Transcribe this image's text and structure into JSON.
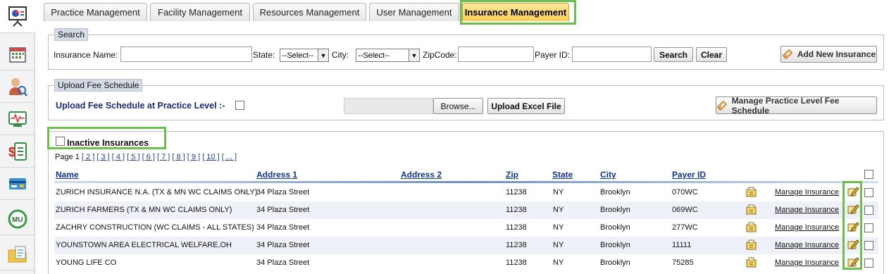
{
  "sidebar": {
    "items": [
      {
        "icon": "presentation-chart-icon"
      },
      {
        "icon": "calendar-icon"
      },
      {
        "icon": "user-search-icon"
      },
      {
        "icon": "heartbeat-monitor-icon"
      },
      {
        "icon": "billing-document-icon"
      },
      {
        "icon": "credit-card-icon"
      },
      {
        "icon": "mu-cycle-icon"
      },
      {
        "icon": "folder-documents-icon"
      }
    ]
  },
  "tabs": [
    {
      "label": "Practice Management",
      "active": false
    },
    {
      "label": "Facility Management",
      "active": false
    },
    {
      "label": "Resources Management",
      "active": false
    },
    {
      "label": "User Management",
      "active": false
    },
    {
      "label": "Insurance Management",
      "active": true
    }
  ],
  "search": {
    "legend": "Search",
    "insurance_name_label": "Insurance Name:",
    "insurance_name_value": "",
    "state_label": "State:",
    "state_value": "--Select--",
    "city_label": "City:",
    "city_value": "--Select--",
    "zip_label": "ZipCode:",
    "zip_value": "",
    "payer_label": "Payer ID:",
    "payer_value": "",
    "search_button": "Search",
    "clear_button": "Clear",
    "add_button": "Add New Insurance"
  },
  "upload": {
    "legend": "Upload Fee Schedule",
    "practice_level_label": "Upload Fee Schedule at Practice Level :-",
    "browse_button": "Browse...",
    "upload_button": "Upload Excel File",
    "manage_button": "Manage Practice Level Fee Schedule"
  },
  "list": {
    "inactive_label": "Inactive Insurances",
    "page_label": "Page 1",
    "pages": [
      "[ 2 ]",
      "[ 3 ]",
      "[ 4 ]",
      "[ 5 ]",
      "[ 6 ]",
      "[ 7 ]",
      "[ 8 ]",
      "[ 9 ]",
      "[ 10 ]",
      "[ ... ]"
    ],
    "columns": {
      "name": "Name",
      "address1": "Address 1",
      "address2": "Address 2",
      "zip": "Zip",
      "state": "State",
      "city": "City",
      "payer": "Payer ID"
    },
    "manage_link": "Manage Insurance",
    "rows": [
      {
        "name": "ZURICH INSURANCE N.A. (TX & MN WC CLAIMS ONLY)",
        "address1": "34 Plaza Street",
        "address2": "",
        "zip": "11238",
        "state": "NY",
        "city": "Brooklyn",
        "payer": "070WC"
      },
      {
        "name": "ZURICH FARMERS (TX & MN WC CLAIMS ONLY)",
        "address1": "34 Plaza Street",
        "address2": "",
        "zip": "11238",
        "state": "NY",
        "city": "Brooklyn",
        "payer": "069WC"
      },
      {
        "name": "ZACHRY CONSTRUCTION (WC CLAIMS - ALL STATES)",
        "address1": "34 Plaza Street",
        "address2": "",
        "zip": "11238",
        "state": "NY",
        "city": "Brooklyn",
        "payer": "277WC"
      },
      {
        "name": "YOUNSTOWN AREA ELECTRICAL WELFARE,OH",
        "address1": "34 Plaza Street",
        "address2": "",
        "zip": "11238",
        "state": "NY",
        "city": "Brooklyn",
        "payer": "11111"
      },
      {
        "name": "YOUNG LIFE CO",
        "address1": "34 Plaza Street",
        "address2": "",
        "zip": "11238",
        "state": "NY",
        "city": "Brooklyn",
        "payer": "75285"
      }
    ]
  },
  "colors": {
    "highlight": "#6cc04a",
    "active_tab": "#f7cd56",
    "header_link": "#12309a"
  }
}
